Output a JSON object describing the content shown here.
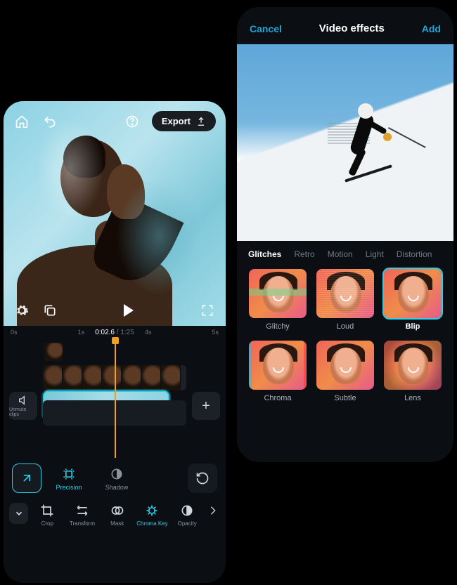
{
  "editor": {
    "top": {
      "home_icon": "home",
      "undo_icon": "undo",
      "help_icon": "help",
      "export_label": "Export"
    },
    "controls": {
      "settings_icon": "gear",
      "copy_icon": "copy",
      "play_icon": "play",
      "fullscreen_icon": "fullscreen"
    },
    "time": {
      "marks": [
        "0s",
        "1s",
        "4s",
        "5s"
      ],
      "current": "0:02.6",
      "duration": "1:25"
    },
    "timeline": {
      "unmute_label": "Unmute clips",
      "add_label": "+"
    },
    "tool_row1": {
      "expand_icon": "expand",
      "precision_label": "Precision",
      "shadow_label": "Shadow",
      "reset_icon": "reset"
    },
    "tool_row2": {
      "items": [
        {
          "key": "crop",
          "label": "Crop"
        },
        {
          "key": "transform",
          "label": "Transform"
        },
        {
          "key": "mask",
          "label": "Mask"
        },
        {
          "key": "chromakey",
          "label": "Chroma Key"
        },
        {
          "key": "opacity",
          "label": "Opacity"
        }
      ]
    }
  },
  "effects": {
    "cancel_label": "Cancel",
    "title": "Video effects",
    "add_label": "Add",
    "tabs": [
      "Glitches",
      "Retro",
      "Motion",
      "Light",
      "Distortion"
    ],
    "active_tab": "Glitches",
    "items": [
      {
        "label": "Glitchy",
        "variant": "glitch",
        "selected": false
      },
      {
        "label": "Loud",
        "variant": "loud",
        "selected": false
      },
      {
        "label": "Blip",
        "variant": "blip",
        "selected": true
      },
      {
        "label": "Chroma",
        "variant": "chroma",
        "selected": false
      },
      {
        "label": "Subtle",
        "variant": "subtle",
        "selected": false
      },
      {
        "label": "Lens",
        "variant": "lens",
        "selected": false
      }
    ]
  }
}
